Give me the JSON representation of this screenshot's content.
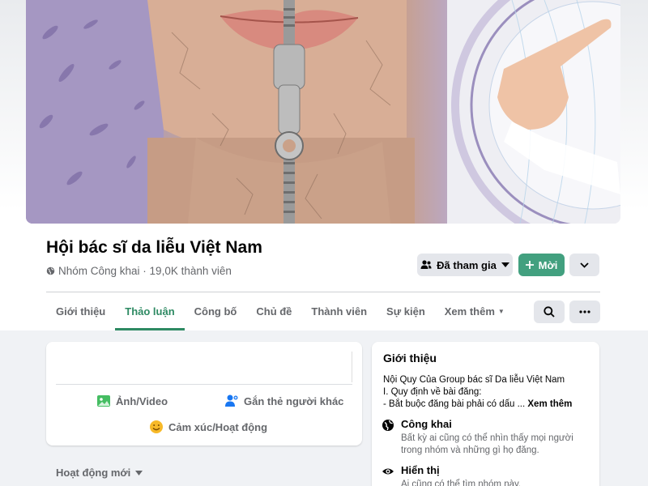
{
  "group": {
    "name": "Hội bác sĩ da liễu Việt Nam",
    "meta": "Nhóm Công khai · 19,0K thành viên"
  },
  "actions": {
    "joined_label": "Đã tham gia",
    "invite_label": "Mời"
  },
  "tabs": [
    {
      "label": "Giới thiệu"
    },
    {
      "label": "Thảo luận"
    },
    {
      "label": "Công bố"
    },
    {
      "label": "Chủ đề"
    },
    {
      "label": "Thành viên"
    },
    {
      "label": "Sự kiện"
    },
    {
      "label": "Xem thêm"
    }
  ],
  "composer": {
    "photo_label": "Ảnh/Video",
    "tag_label": "Gắn thẻ người khác",
    "feeling_label": "Cảm xúc/Hoạt động"
  },
  "feed": {
    "sort_label": "Hoạt động mới"
  },
  "about": {
    "title": "Giới thiệu",
    "line1": "Nội Quy Của Group bác sĩ Da liễu Việt Nam",
    "line2": "I. Quy định về bài đăng:",
    "line3": "- Bắt buộc đăng bài phải có dấu ...",
    "see_more": "Xem thêm",
    "public_title": "Công khai",
    "public_desc": "Bất kỳ ai cũng có thể nhìn thấy mọi người trong nhóm và những gì họ đăng.",
    "visible_title": "Hiển thị",
    "visible_desc": "Ai cũng có thể tìm nhóm này."
  },
  "colors": {
    "accent": "#2e8a63",
    "invite_button": "#42a07f",
    "secondary_button": "#e4e6eb"
  },
  "icons": {
    "meta": "globe-icon",
    "joined": "people-icon",
    "invite": "plus-icon",
    "more": "chevron-down-icon",
    "search": "search-icon",
    "dots": "more-dots-icon"
  }
}
